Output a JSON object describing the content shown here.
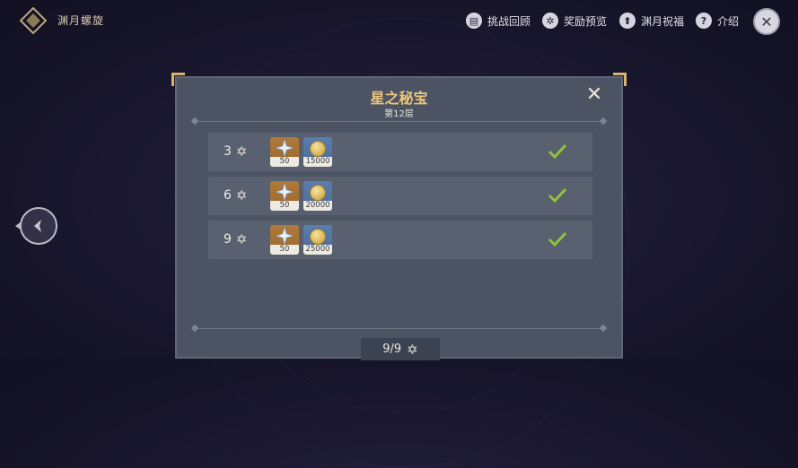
{
  "header": {
    "app_title": "渊月螺旋",
    "buttons": [
      {
        "label": "挑战回顾",
        "icon": "book-icon"
      },
      {
        "label": "奖励预览",
        "icon": "gear-icon"
      },
      {
        "label": "渊月祝福",
        "icon": "up-arrow-icon"
      },
      {
        "label": "介绍",
        "icon": "question-icon"
      }
    ],
    "close_icon": "close-icon"
  },
  "panel": {
    "title": "星之秘宝",
    "subtitle": "第12层",
    "rows": [
      {
        "stars": "3",
        "reward1_qty": "50",
        "reward2_qty": "15000",
        "claimed": true
      },
      {
        "stars": "6",
        "reward1_qty": "50",
        "reward2_qty": "20000",
        "claimed": true
      },
      {
        "stars": "9",
        "reward1_qty": "50",
        "reward2_qty": "25000",
        "claimed": true
      }
    ],
    "progress": "9/9"
  },
  "colors": {
    "accent_gold": "#edc579",
    "panel_bg": "#4c5464",
    "check_green": "#8fc43a"
  }
}
